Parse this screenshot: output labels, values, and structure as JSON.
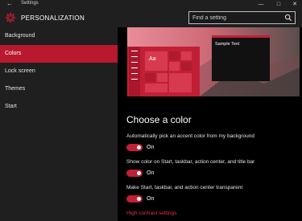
{
  "window": {
    "title": "Settings",
    "back_glyph": "←",
    "controls": [
      "—",
      "□",
      "✕"
    ]
  },
  "header": {
    "icon": "gear-icon",
    "title": "PERSONALIZATION"
  },
  "search": {
    "placeholder": "Find a setting",
    "value": "",
    "icon": "search-icon"
  },
  "sidebar": {
    "items": [
      {
        "label": "Background",
        "active": false
      },
      {
        "label": "Colors",
        "active": true
      },
      {
        "label": "Lock screen",
        "active": false
      },
      {
        "label": "Themes",
        "active": false
      },
      {
        "label": "Start",
        "active": false
      }
    ]
  },
  "preview": {
    "tile_label": "Aa",
    "sample_text": "Sample Text"
  },
  "main": {
    "section_title": "Choose a color",
    "options": [
      {
        "label": "Automatically pick an accent color from my background",
        "state": "On"
      },
      {
        "label": "Show color on Start, taskbar, action center, and title bar",
        "state": "On"
      },
      {
        "label": "Make Start, taskbar, and action center transparent",
        "state": "On"
      }
    ],
    "link": "High contrast settings"
  },
  "colors": {
    "accent": "#c11f35",
    "sidebar_bg": "#1f1f1f",
    "content_bg": "#000000",
    "link": "#e2334a"
  }
}
